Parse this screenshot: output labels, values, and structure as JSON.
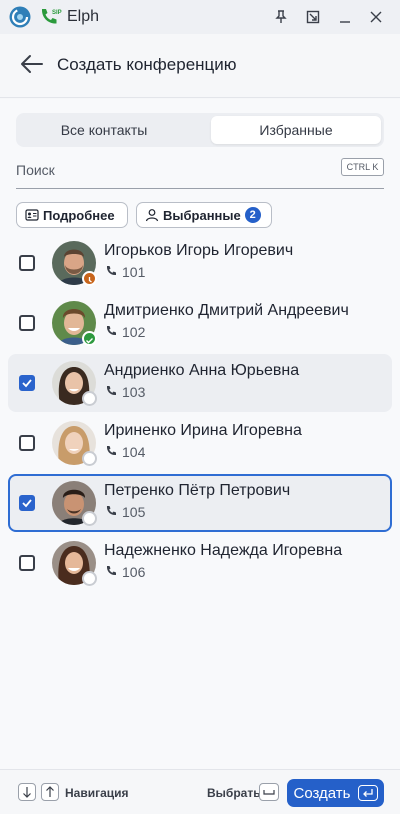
{
  "window": {
    "app_name": "Elph",
    "sip_badge": "SIP"
  },
  "header": {
    "title": "Создать конференцию"
  },
  "tabs": [
    {
      "label": "Все контакты",
      "active": false
    },
    {
      "label": "Избранные",
      "active": true
    }
  ],
  "search": {
    "placeholder": "Поиск",
    "value": "",
    "shortcut": "CTRL K"
  },
  "filters": {
    "details_label": "Подробнее",
    "selected_label": "Выбранные",
    "selected_count": "2"
  },
  "contacts": [
    {
      "name": "Игорьков Игорь Игоревич",
      "ext": "101",
      "checked": false,
      "status": "away",
      "status_color": "#c8651b"
    },
    {
      "name": "Дмитриенко Дмитрий Андреевич",
      "ext": "102",
      "checked": false,
      "status": "online",
      "status_color": "#2e9a3f"
    },
    {
      "name": "Андриенко Анна Юрьевна",
      "ext": "103",
      "checked": true,
      "status": "offline",
      "status_color": "#c9ccd2"
    },
    {
      "name": "Ириненко Ирина Игоревна",
      "ext": "104",
      "checked": false,
      "status": "offline",
      "status_color": "#c9ccd2"
    },
    {
      "name": "Петренко Пётр Петрович",
      "ext": "105",
      "checked": true,
      "status": "offline",
      "status_color": "#c9ccd2"
    },
    {
      "name": "Надежненко Надежда Игоревна",
      "ext": "106",
      "checked": false,
      "status": "offline",
      "status_color": "#c9ccd2"
    }
  ],
  "footer": {
    "nav_label": "Навигация",
    "select_label": "Выбрать",
    "create_label": "Создать"
  },
  "colors": {
    "accent": "#2560c9",
    "focus_border": "#2f6dd3"
  }
}
